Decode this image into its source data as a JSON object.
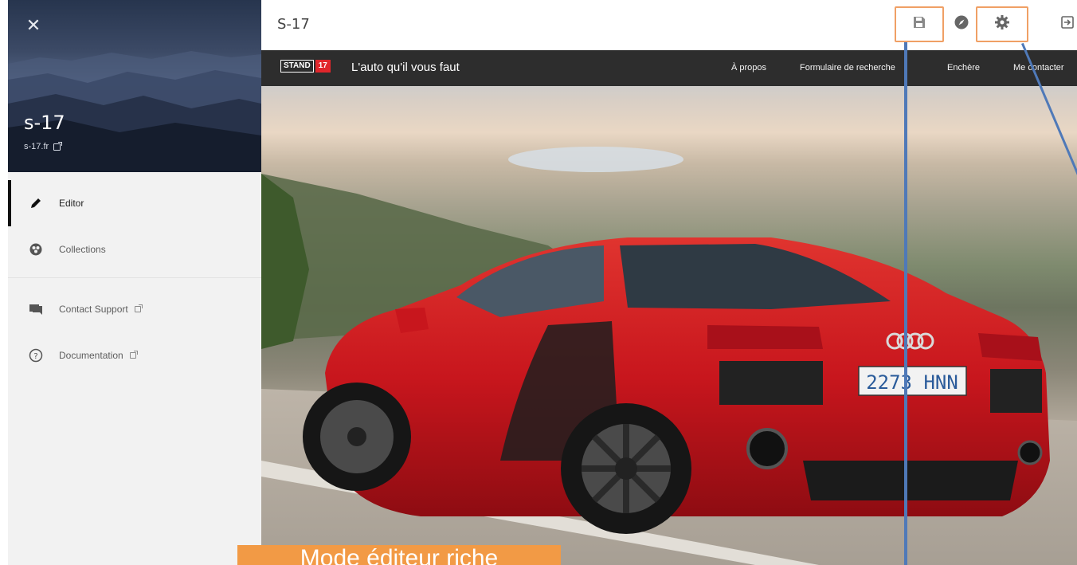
{
  "sidebar": {
    "close_icon": "close-icon",
    "site_name": "s-17",
    "site_domain": "s-17.fr",
    "nav": [
      {
        "label": "Editor",
        "icon": "pencil-icon",
        "active": true
      },
      {
        "label": "Collections",
        "icon": "collections-icon",
        "active": false
      }
    ],
    "links": [
      {
        "label": "Contact Support",
        "icon": "chat-icon",
        "external": true
      },
      {
        "label": "Documentation",
        "icon": "help-circle-icon",
        "external": true
      }
    ]
  },
  "topbar": {
    "title": "S-17",
    "tools": [
      {
        "name": "save",
        "icon": "save-icon",
        "highlighted": true
      },
      {
        "name": "preview",
        "icon": "compass-icon",
        "highlighted": false
      },
      {
        "name": "settings",
        "icon": "gear-icon",
        "highlighted": true
      },
      {
        "name": "exit",
        "icon": "exit-icon",
        "highlighted": false
      }
    ]
  },
  "site_preview": {
    "logo_stand": "STAND",
    "logo_number": "17",
    "tagline": "L'auto qu'il vous faut",
    "nav_links": [
      "À propos",
      "Formulaire de recherche",
      "Enchère",
      "Me contacter"
    ],
    "license_plate": "2273 HNN"
  },
  "annotation": {
    "label": "Mode éditeur riche",
    "highlight_color": "#f0a065",
    "line_color": "#4f79b8",
    "label_background": "#f29a45"
  },
  "colors": {
    "sidebar_bg": "#f2f2f2",
    "site_nav_bg": "#2d2d2d",
    "logo_red": "#e0262b",
    "car_red": "#c8161d"
  }
}
